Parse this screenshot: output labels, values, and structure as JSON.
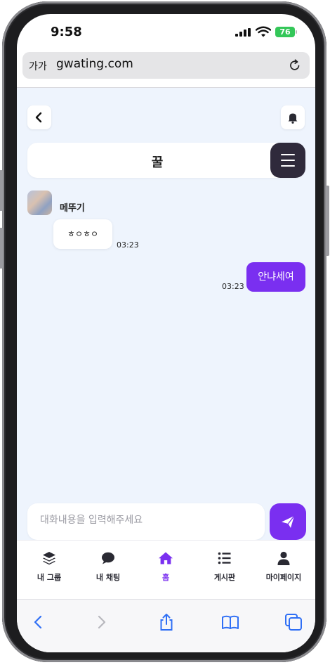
{
  "status_bar": {
    "time": "9:58",
    "battery": "76"
  },
  "browser": {
    "aa_label": "가가",
    "url": "gwating.com"
  },
  "chat": {
    "title": "꿀",
    "messages": [
      {
        "sender": "메뚜기",
        "text": "ㅎㅇㅎㅇ",
        "time": "03:23",
        "direction": "incoming"
      },
      {
        "text": "안냐세여",
        "time": "03:23",
        "direction": "outgoing"
      }
    ]
  },
  "input": {
    "placeholder": "대화내용을 입력해주세요",
    "value": ""
  },
  "tabs": [
    {
      "label": "내 그룹",
      "icon": "layers-icon",
      "active": false
    },
    {
      "label": "내 채팅",
      "icon": "chat-bubble-icon",
      "active": false
    },
    {
      "label": "홈",
      "icon": "home-icon",
      "active": true
    },
    {
      "label": "게시판",
      "icon": "list-icon",
      "active": false
    },
    {
      "label": "마이페이지",
      "icon": "user-icon",
      "active": false
    }
  ],
  "colors": {
    "accent": "#7a2ff0",
    "menu_button": "#2f2a3b",
    "chat_background": "#eef4fd",
    "battery": "#34c759"
  }
}
